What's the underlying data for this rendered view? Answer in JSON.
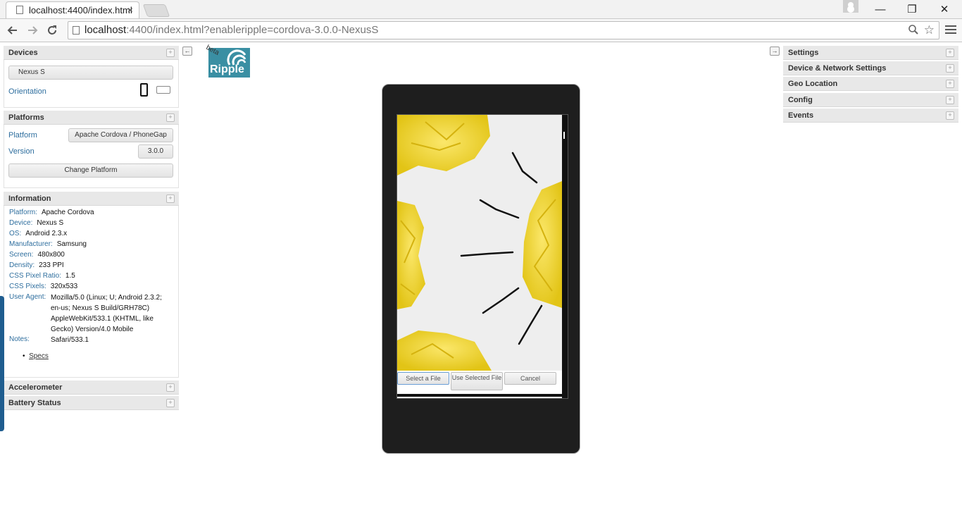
{
  "browser": {
    "tab_title": "localhost:4400/index.html",
    "tab_close": "×",
    "url_host": "localhost",
    "url_rest": ":4400/index.html?enableripple=cordova-3.0.0-NexusS",
    "window_buttons": {
      "minimize": "—",
      "restore": "❐",
      "close": "✕"
    }
  },
  "logo": {
    "badge": "beta",
    "name": "Ripple"
  },
  "left": {
    "devices": {
      "title": "Devices",
      "device_value": "Nexus S",
      "orientation_label": "Orientation"
    },
    "platforms": {
      "title": "Platforms",
      "platform_label": "Platform",
      "platform_value": "Apache Cordova / PhoneGap",
      "version_label": "Version",
      "version_value": "3.0.0",
      "change_button": "Change Platform"
    },
    "information": {
      "title": "Information",
      "rows": [
        {
          "k": "Platform:",
          "v": "Apache Cordova"
        },
        {
          "k": "Device:",
          "v": "Nexus S"
        },
        {
          "k": "OS:",
          "v": "Android 2.3.x"
        },
        {
          "k": "Manufacturer:",
          "v": "Samsung"
        },
        {
          "k": "Screen:",
          "v": "480x800"
        },
        {
          "k": "Density:",
          "v": "233 PPI"
        },
        {
          "k": "CSS Pixel Ratio:",
          "v": "1.5"
        },
        {
          "k": "CSS Pixels:",
          "v": "320x533"
        }
      ],
      "user_agent_label": "User Agent:",
      "user_agent_value": "Mozilla/5.0 (Linux; U; Android 2.3.2; en-us; Nexus S Build/GRH78C) AppleWebKit/533.1 (KHTML, like Gecko) Version/4.0 Mobile Safari/533.1",
      "notes_label": "Notes:",
      "specs_link": "Specs"
    },
    "accelerometer": {
      "title": "Accelerometer"
    },
    "battery": {
      "title": "Battery Status"
    }
  },
  "right": {
    "panels": [
      "Settings",
      "Device & Network Settings",
      "Geo Location",
      "Config",
      "Events"
    ]
  },
  "screen": {
    "select_button": "Select a File",
    "use_button": "Use Selected File",
    "cancel_button": "Cancel"
  },
  "icons": {
    "plus": "+",
    "collapse_left": "←",
    "collapse_right": "→"
  },
  "colors": {
    "label_blue": "#2e6e9e",
    "paper_yellow": "#f2d92b",
    "device_body": "#1e1e1e",
    "ripple_teal": "#3a8fa3"
  }
}
